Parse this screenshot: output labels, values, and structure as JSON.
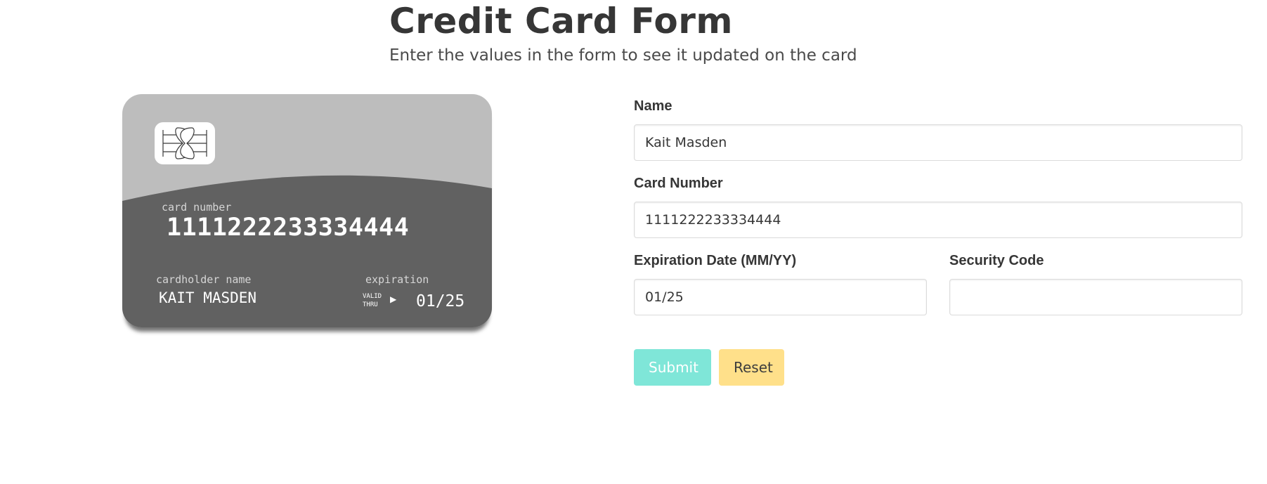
{
  "page": {
    "title": "Credit Card Form",
    "subtitle": "Enter the values in the form to see it updated on the card"
  },
  "card": {
    "chip_icon": "card-chip-icon",
    "number_label": "card number",
    "number_value": "1111222233334444",
    "name_label": "cardholder name",
    "name_value": "KAIT MASDEN",
    "expiration_label": "expiration",
    "valid_thru_line1": "VALID",
    "valid_thru_line2": "THRU",
    "arrow_glyph": "▶",
    "expiration_value": "01/25",
    "colors": {
      "top": "#bdbdbd",
      "bottom": "#616161"
    }
  },
  "form": {
    "name": {
      "label": "Name",
      "value": "Kait Masden"
    },
    "card_number": {
      "label": "Card Number",
      "value": "1111222233334444"
    },
    "expiration": {
      "label": "Expiration Date (MM/YY)",
      "value": "01/25"
    },
    "security_code": {
      "label": "Security Code",
      "value": ""
    },
    "submit_label": "Submit",
    "reset_label": "Reset",
    "colors": {
      "submit": "#7fe6d8",
      "reset": "#ffe08a"
    }
  }
}
